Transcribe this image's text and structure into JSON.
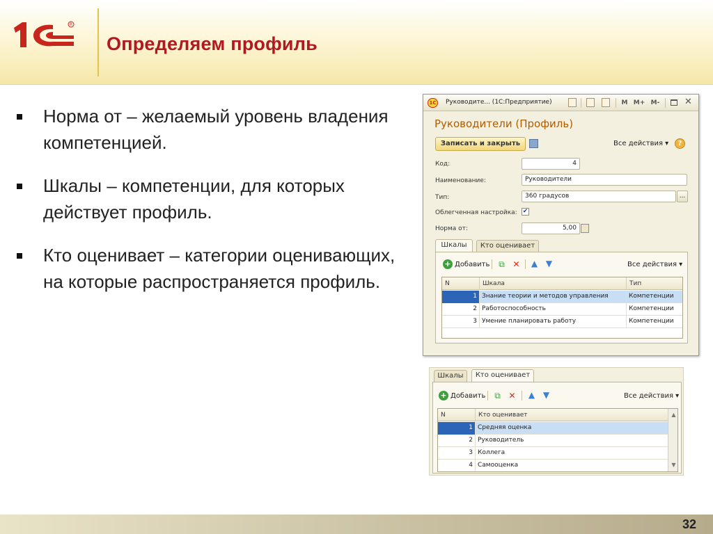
{
  "slide": {
    "title": "Определяем профиль",
    "page_number": "32",
    "logo_text": "1С"
  },
  "bullets": [
    "Норма от – желаемый уровень владения компетенцией.",
    "Шкалы – компетенции, для которых действует профиль.",
    "Кто оценивает – категории оценивающих, на которые распространяется профиль."
  ],
  "form": {
    "window_title": "Руководите... (1С:Предприятие)",
    "titlebar_buttons": [
      "M",
      "M+",
      "M-"
    ],
    "heading": "Руководители (Профиль)",
    "save_close_label": "Записать и закрыть",
    "all_actions_label": "Все действия ▾",
    "help_label": "?",
    "fields": {
      "code_label": "Код:",
      "code_value": "4",
      "name_label": "Наименование:",
      "name_value": "Руководители",
      "type_label": "Тип:",
      "type_value": "360 градусов",
      "type_button": "...",
      "simplified_label": "Облегченная настройка:",
      "simplified_checked": true,
      "simplified_mark": "✔",
      "norm_label": "Норма от:",
      "norm_value": "5,00"
    },
    "tabs": [
      "Шкалы",
      "Кто оценивает"
    ],
    "add_label": "Добавить",
    "scales_table": {
      "headers": [
        "N",
        "Шкала",
        "Тип"
      ],
      "rows": [
        {
          "n": "1",
          "scale": "Знание теории и методов управления",
          "type": "Компетенции"
        },
        {
          "n": "2",
          "scale": "Работоспособность",
          "type": "Компетенции"
        },
        {
          "n": "3",
          "scale": "Умение планировать работу",
          "type": "Компетенции"
        }
      ],
      "selected_row": 0
    }
  },
  "panel2": {
    "tabs": [
      "Шкалы",
      "Кто оценивает"
    ],
    "add_label": "Добавить",
    "all_actions_label": "Все действия ▾",
    "evaluators_table": {
      "headers": [
        "N",
        "Кто оценивает"
      ],
      "rows": [
        {
          "n": "1",
          "who": "Средняя оценка"
        },
        {
          "n": "2",
          "who": "Руководитель"
        },
        {
          "n": "3",
          "who": "Коллега"
        },
        {
          "n": "4",
          "who": "Самооценка"
        }
      ],
      "selected_row": 0
    }
  },
  "colors": {
    "title_red": "#b0191f",
    "form_heading_orange": "#b05c00",
    "selection_blue": "#2c64b8",
    "row_highlight": "#c8def5"
  }
}
